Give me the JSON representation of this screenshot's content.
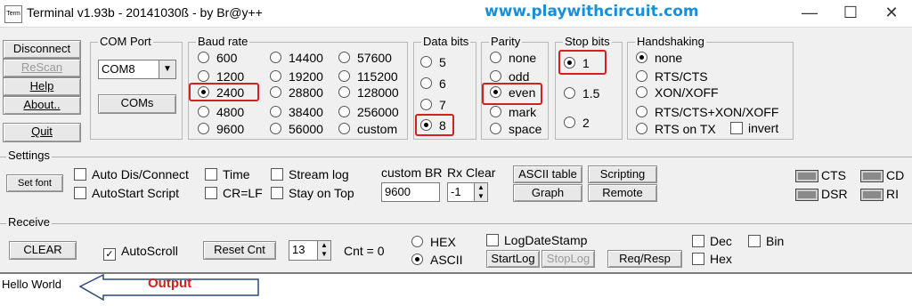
{
  "window": {
    "title": "Terminal v1.93b - 20141030ß - by Br@y++",
    "watermark": "www.playwithcircuit.com",
    "icon_text": "Term"
  },
  "left_buttons": {
    "disconnect": "Disconnect",
    "rescan": "ReScan",
    "help": "Help",
    "about": "About..",
    "quit": "Quit"
  },
  "com_port": {
    "title": "COM Port",
    "value": "COM8",
    "coms_button": "COMs"
  },
  "baud_rate": {
    "title": "Baud rate",
    "options": [
      "600",
      "1200",
      "2400",
      "4800",
      "9600",
      "14400",
      "19200",
      "28800",
      "38400",
      "56000",
      "57600",
      "115200",
      "128000",
      "256000",
      "custom"
    ],
    "selected": "2400"
  },
  "data_bits": {
    "title": "Data bits",
    "options": [
      "5",
      "6",
      "7",
      "8"
    ],
    "selected": "8"
  },
  "parity": {
    "title": "Parity",
    "options": [
      "none",
      "odd",
      "even",
      "mark",
      "space"
    ],
    "selected": "even"
  },
  "stop_bits": {
    "title": "Stop bits",
    "options": [
      "1",
      "1.5",
      "2"
    ],
    "selected": "1"
  },
  "handshaking": {
    "title": "Handshaking",
    "options": [
      "none",
      "RTS/CTS",
      "XON/XOFF",
      "RTS/CTS+XON/XOFF",
      "RTS on TX"
    ],
    "selected": "none",
    "invert_label": "invert"
  },
  "settings": {
    "title": "Settings",
    "set_font": "Set font",
    "auto_dis_connect": "Auto Dis/Connect",
    "autostart_script": "AutoStart Script",
    "time": "Time",
    "cr_lf": "CR=LF",
    "stream_log": "Stream log",
    "stay_on_top": "Stay on Top",
    "custom_br_label": "custom BR",
    "custom_br_value": "9600",
    "rx_clear_label": "Rx Clear",
    "rx_clear_value": "-1",
    "ascii_table": "ASCII table",
    "graph": "Graph",
    "scripting": "Scripting",
    "remote": "Remote",
    "leds": {
      "cts": "CTS",
      "cd": "CD",
      "dsr": "DSR",
      "ri": "RI"
    }
  },
  "receive": {
    "title": "Receive",
    "clear": "CLEAR",
    "autoscroll": "AutoScroll",
    "reset_cnt": "Reset Cnt",
    "cnt_spin": "13",
    "cnt_label": "Cnt = 0",
    "hex": "HEX",
    "ascii": "ASCII",
    "mode_selected": "ASCII",
    "logdatestamp": "LogDateStamp",
    "startlog": "StartLog",
    "stoplog": "StopLog",
    "req_resp": "Req/Resp",
    "dec": "Dec",
    "bin": "Bin",
    "hex_check": "Hex"
  },
  "output": {
    "text": "Hello World",
    "annotation": "Output",
    "annotation_color": "#d42020",
    "arrow_color": "#2a4a80"
  },
  "highlight_color": "#d42020"
}
